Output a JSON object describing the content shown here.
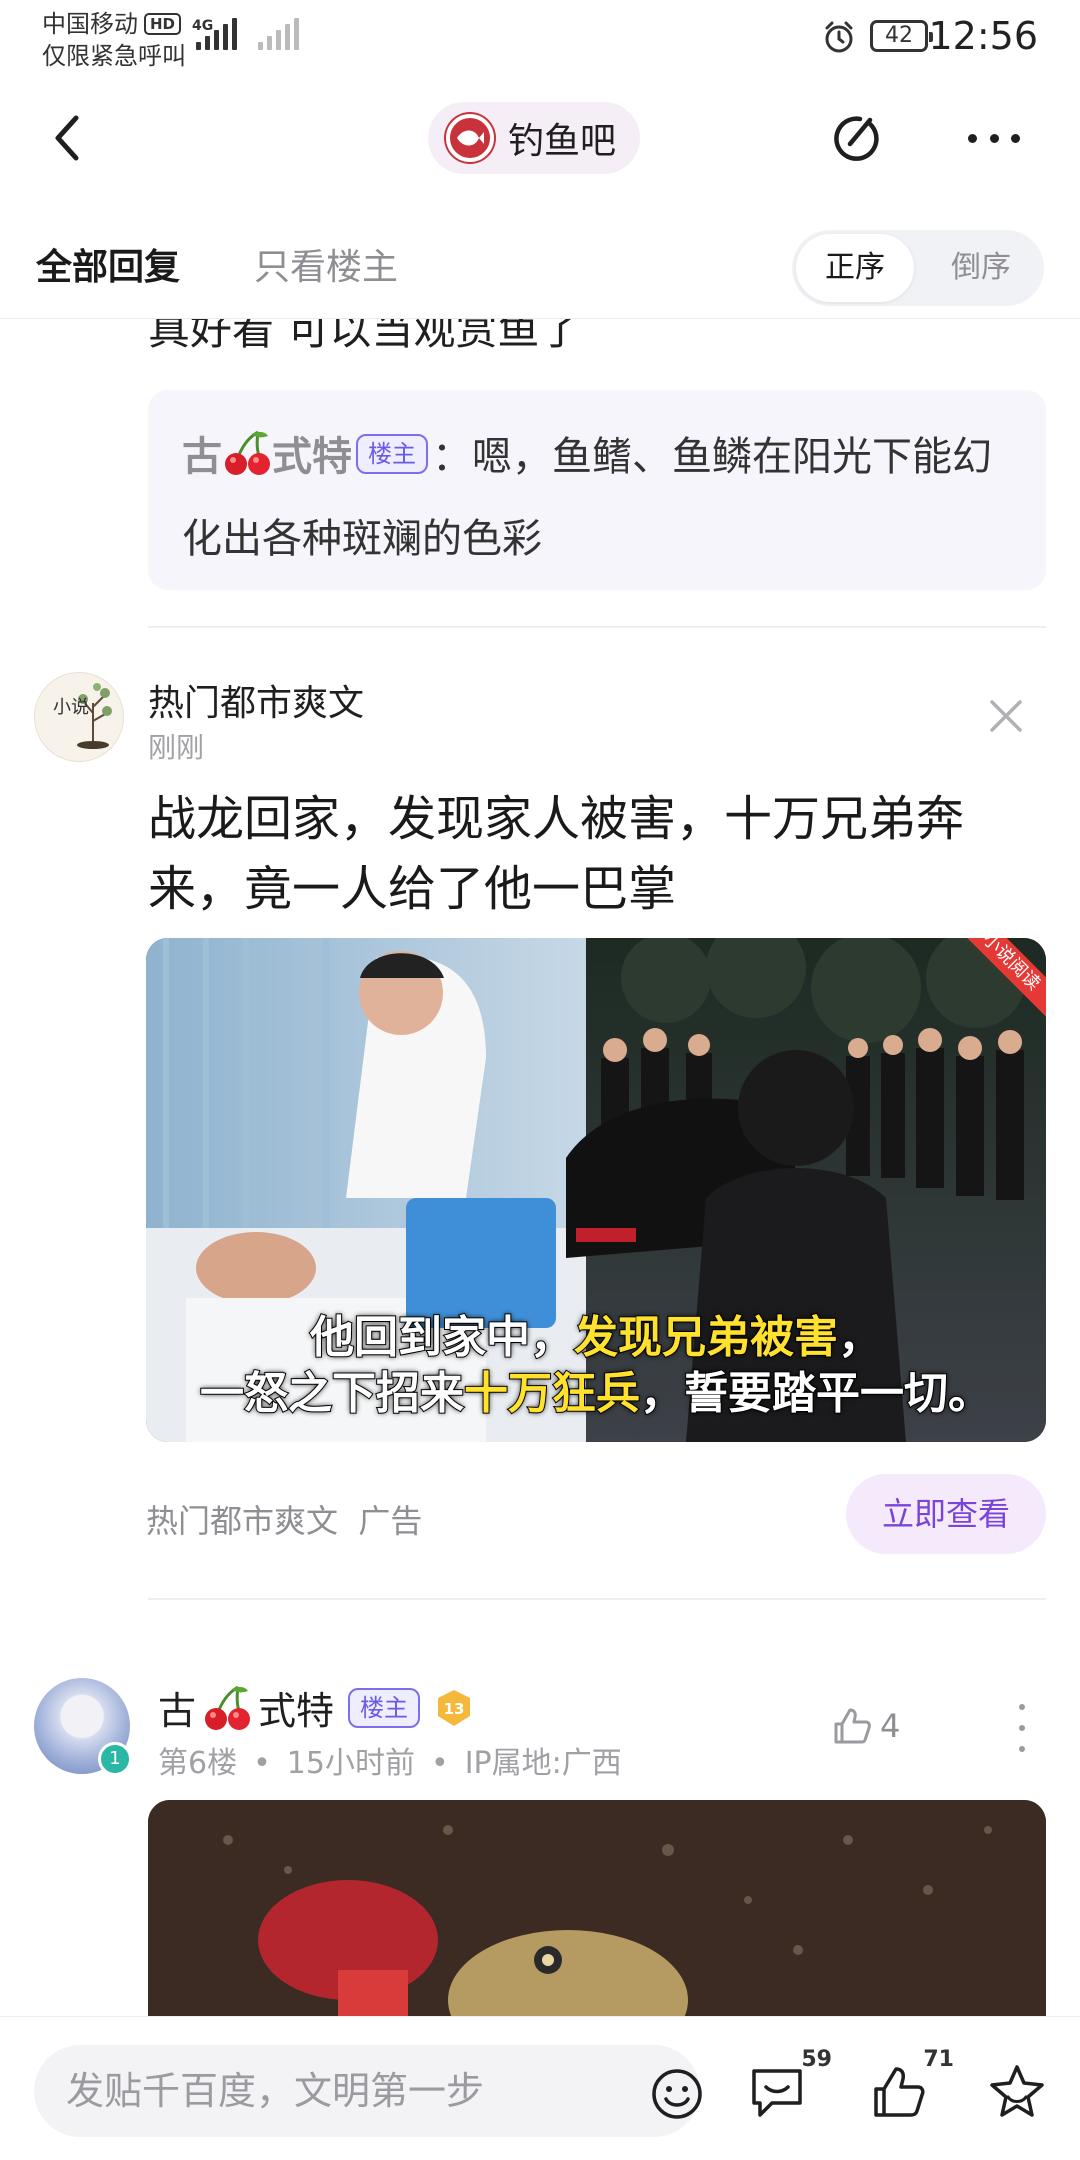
{
  "status_bar": {
    "carrier": "中国移动",
    "carrier_badge": "HD",
    "network": "4G",
    "emergency": "仅限紧急呼叫",
    "battery": "42",
    "time": "12:56"
  },
  "header": {
    "forum_name": "钓鱼吧"
  },
  "tabs": {
    "all_replies": "全部回复",
    "owner_only": "只看楼主",
    "order_asc": "正序",
    "order_desc": "倒序"
  },
  "prev_post": {
    "clipped_text": "真好看 可以当观赏鱼了",
    "reply_author_a": "古",
    "reply_author_b": "式特",
    "reply_owner_tag": "楼主",
    "reply_text": "：嗯，鱼鳍、鱼鳞在阳光下能幻化出各种斑斓的色彩"
  },
  "ad": {
    "avatar_text": "小说",
    "name": "热门都市爽文",
    "time": "刚刚",
    "title": "战龙回家，发现家人被害，十万兄弟奔来，竟一人给了他一巴掌",
    "caption_line1_a": "他回到家中，",
    "caption_line1_b": "发现兄弟被害",
    "caption_line1_c": "，",
    "caption_line2_a": "一怒之下招来",
    "caption_line2_b": "十万狂兵",
    "caption_line2_c": "，誓要踏平一切。",
    "corner_label": "小说阅读",
    "source": "热门都市爽文  广告",
    "cta": "立即查看"
  },
  "post": {
    "author_a": "古",
    "author_b": "式特",
    "owner_tag": "楼主",
    "vip_level": "13",
    "user_level": "1",
    "floor": "第6楼",
    "time_ago": "15小时前",
    "ip": "IP属地:广西",
    "likes": "4"
  },
  "bottom_bar": {
    "compose_placeholder": "发贴千百度，文明第一步",
    "comment_count": "59",
    "like_count": "71"
  }
}
